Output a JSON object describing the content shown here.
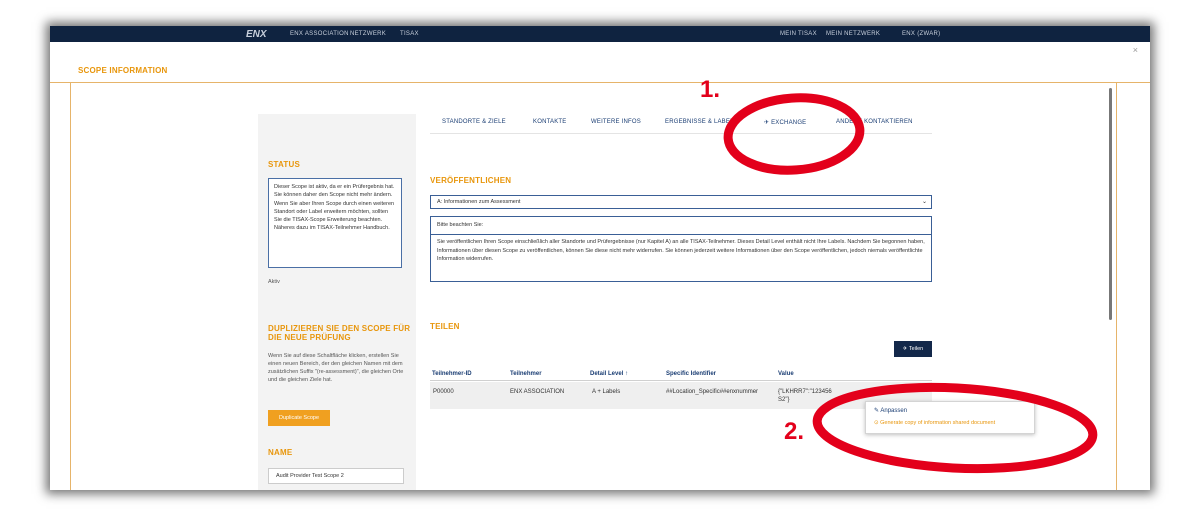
{
  "topnav": {
    "brand": "ENX",
    "items": [
      "ENX ASSOCIATION",
      "NETZWERK",
      "TISAX",
      "MEIN TISAX",
      "MEIN NETZWERK",
      "ENX (ZWAR)"
    ]
  },
  "modal": {
    "title": "SCOPE INFORMATION",
    "close": "×"
  },
  "left": {
    "status_head": "STATUS",
    "status_text": "Dieser Scope ist aktiv, da er ein Prüfergebnis hat. Sie können daher den Scope nicht mehr ändern. Wenn Sie aber Ihren Scope durch einen weiteren Standort oder Label erweitern möchten, sollten Sie die TISAX-Scope Erweiterung beachten. Näheres dazu im TISAX-Teilnehmer Handbuch.",
    "status_value": "Aktiv",
    "dup_head_1": "DUPLIZIEREN SIE DEN SCOPE FÜR",
    "dup_head_2": "DIE NEUE PRÜFUNG",
    "dup_text": "Wenn Sie auf diese Schaltfläche klicken, erstellen Sie einen neuen Bereich, der den gleichen Namen mit dem zusätzlichen Suffix \"(re-assessment)\", die gleichen Orte und die gleichen Ziele hat.",
    "dup_button": "Duplicate Scope",
    "name_head": "NAME",
    "name_value": "Audit Provider Test Scope 2"
  },
  "tabs": [
    "STANDORTE & ZIELE",
    "KONTAKTE",
    "WEITERE INFOS",
    "ERGEBNISSE & LABELS",
    "EXCHANGE",
    "ANDERE KONTAKTIEREN"
  ],
  "publish": {
    "head": "VERÖFFENTLICHEN",
    "select_value": "A: Informationen zum Assessment",
    "note_head": "Bitte beachten Sie:",
    "note_text": "Sie veröffentlichen Ihren Scope einschließlich aller Standorte und Prüfergebnisse (nur Kapitel A) an alle TISAX-Teilnehmer. Dieses Detail Level enthält nicht Ihre Labels. Nachdem Sie begonnen haben, Informationen über diesen Scope zu veröffentlichen, können Sie diese nicht mehr widerrufen. Sie können jederzeit weitere Informationen über den Scope veröffentlichen, jedoch niemals veröffentlichte Information widerrufen."
  },
  "share": {
    "head": "TEILEN",
    "button": "Teilen",
    "columns": [
      "Teilnehmer-ID",
      "Teilnehmer",
      "Detail Level ↑",
      "Specific Identifier",
      "Value"
    ],
    "row": [
      "P00000",
      "ENX ASSOCIATION",
      "A + Labels",
      "##Location_Specific##enxnummer",
      "{\"LKHRR7\":\"123456",
      "S2\"}"
    ]
  },
  "menu": {
    "item1": "Anpassen",
    "item2": "Generate copy of information shared document"
  },
  "annotations": {
    "one": "1.",
    "two": "2.",
    "color": "#e3001b"
  },
  "colors": {
    "accent": "#e8960c",
    "navy": "#13284a",
    "link": "#1a3d73"
  }
}
